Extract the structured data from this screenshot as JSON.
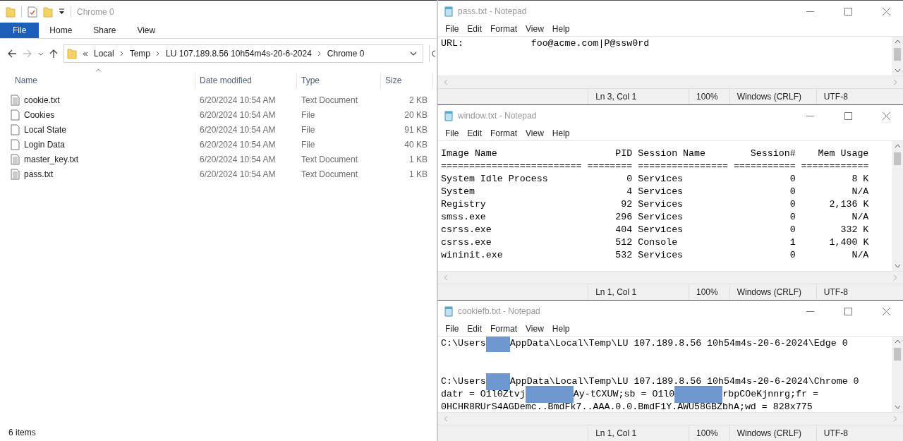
{
  "explorer": {
    "title": "Chrome 0",
    "ribbon_tabs": [
      {
        "label": "File",
        "selected": true
      },
      {
        "label": "Home",
        "selected": false
      },
      {
        "label": "Share",
        "selected": false
      },
      {
        "label": "View",
        "selected": false
      }
    ],
    "nav": {
      "forward_disabled": true
    },
    "breadcrumb": [
      "Local",
      "Temp",
      "LU 107.189.8.56 10h54m4s-20-6-2024",
      "Chrome 0"
    ],
    "columns": [
      "Name",
      "Date modified",
      "Type",
      "Size"
    ],
    "rows": [
      {
        "kind": "text-document",
        "name": "cookie.txt",
        "date": "6/20/2024 10:54 AM",
        "type": "Text Document",
        "size": "2 KB"
      },
      {
        "kind": "file",
        "name": "Cookies",
        "date": "6/20/2024 10:54 AM",
        "type": "File",
        "size": "20 KB"
      },
      {
        "kind": "file",
        "name": "Local State",
        "date": "6/20/2024 10:54 AM",
        "type": "File",
        "size": "91 KB"
      },
      {
        "kind": "file",
        "name": "Login Data",
        "date": "6/20/2024 10:54 AM",
        "type": "File",
        "size": "40 KB"
      },
      {
        "kind": "text-document",
        "name": "master_key.txt",
        "date": "6/20/2024 10:54 AM",
        "type": "Text Document",
        "size": "1 KB"
      },
      {
        "kind": "text-document",
        "name": "pass.txt",
        "date": "6/20/2024 10:54 AM",
        "type": "Text Document",
        "size": "1 KB"
      }
    ],
    "status": "6 items"
  },
  "notepads": [
    {
      "title": "pass.txt - Notepad",
      "menu": [
        "File",
        "Edit",
        "Format",
        "View",
        "Help"
      ],
      "document": {
        "kind": "lines",
        "lines": [
          {
            "kind": "text",
            "segments": [
              {
                "kind": "text",
                "text": "URL:            foo@acme.com|P@ssw0rd"
              }
            ]
          }
        ]
      },
      "status": [
        "Ln 3, Col 1",
        "100%",
        "Windows (CRLF)",
        "UTF-8"
      ]
    },
    {
      "title": "window.txt - Notepad",
      "menu": [
        "File",
        "Edit",
        "Format",
        "View",
        "Help"
      ],
      "document": {
        "kind": "table",
        "columns": [
          "Image Name",
          "PID",
          "Session Name",
          "Session#",
          "Mem Usage"
        ],
        "separators": [
          "=========================",
          "========",
          "================",
          "===========",
          "============"
        ],
        "rows": [
          [
            "System Idle Process",
            "0",
            "Services",
            "0",
            "8 K"
          ],
          [
            "System",
            "4",
            "Services",
            "0",
            "N/A"
          ],
          [
            "Registry",
            "92",
            "Services",
            "0",
            "2,136 K"
          ],
          [
            "smss.exe",
            "296",
            "Services",
            "0",
            "N/A"
          ],
          [
            "csrss.exe",
            "404",
            "Services",
            "0",
            "332 K"
          ],
          [
            "csrss.exe",
            "512",
            "Console",
            "1",
            "1,400 K"
          ],
          [
            "wininit.exe",
            "532",
            "Services",
            "0",
            "N/A"
          ]
        ]
      },
      "status": [
        "Ln 1, Col 1",
        "100%",
        "Windows (CRLF)",
        "UTF-8"
      ]
    },
    {
      "title": "cookiefb.txt - Notepad",
      "menu": [
        "File",
        "Edit",
        "Format",
        "View",
        "Help"
      ],
      "document": {
        "kind": "lines",
        "lines": [
          {
            "kind": "text",
            "segments": [
              {
                "kind": "text",
                "text": "C:\\Users"
              },
              {
                "kind": "redacted-short"
              },
              {
                "kind": "text",
                "text": "AppData\\Local\\Temp\\LU 107.189.8.56 10h54m4s-20-6-2024\\Edge 0"
              }
            ]
          },
          {
            "kind": "blank"
          },
          {
            "kind": "blank"
          },
          {
            "kind": "text",
            "segments": [
              {
                "kind": "text",
                "text": "C:\\Users"
              },
              {
                "kind": "redacted-short"
              },
              {
                "kind": "text",
                "text": "AppData\\Local\\Temp\\LU 107.189.8.56 10h54m4s-20-6-2024\\Chrome 0"
              }
            ]
          },
          {
            "kind": "text",
            "segments": [
              {
                "kind": "text",
                "text": "datr = O1l0Ztvj"
              },
              {
                "kind": "redacted-long"
              },
              {
                "kind": "text",
                "text": "Ay-tCXUW;sb = O1l0"
              },
              {
                "kind": "redacted-long"
              },
              {
                "kind": "text",
                "text": "rbpCOeKjnnrg;fr ="
              }
            ]
          },
          {
            "kind": "text",
            "segments": [
              {
                "kind": "text",
                "text": "0HCHR8RUrS4AGDemc..BmdFk7..AAA.0.0.BmdF1Y.AWU58GBZbhA;wd = 828x775"
              }
            ]
          }
        ]
      },
      "status": [
        "Ln 1, Col 1",
        "100%",
        "Windows (CRLF)",
        "UTF-8"
      ]
    }
  ]
}
